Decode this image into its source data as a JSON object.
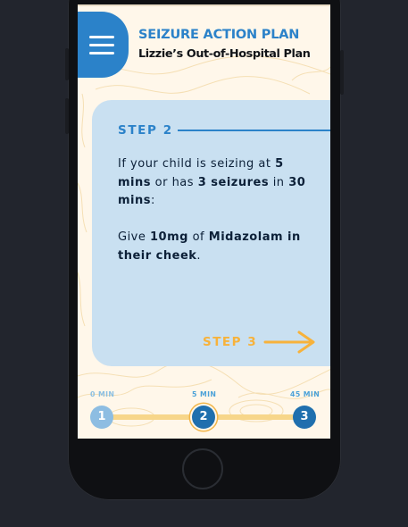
{
  "header": {
    "title": "SEIZURE ACTION PLAN",
    "subtitle": "Lizzie’s Out-of-Hospital Plan",
    "menu_icon": "hamburger-menu-icon"
  },
  "step": {
    "label": "STEP 2",
    "condition": {
      "pre": "If your child is seizing at ",
      "time": "5 mins",
      "mid": " or has ",
      "count": "3 seizures",
      "mid2": " in ",
      "window": "30 mins",
      "post": ":"
    },
    "action": {
      "pre": "Give ",
      "dose": "10mg",
      "mid": " of ",
      "drug": "Midazolam in their cheek",
      "post": "."
    },
    "next_label": "STEP 3",
    "next_icon": "arrow-right-icon"
  },
  "timeline": {
    "points": [
      {
        "label": "0 MIN",
        "number": "1"
      },
      {
        "label": "5 MIN",
        "number": "2"
      },
      {
        "label": "45 MIN",
        "number": "3"
      }
    ],
    "active_index": 1
  },
  "colors": {
    "primary_blue": "#2b82c9",
    "card_blue": "#c9e0f1",
    "accent_yellow": "#f7b23b",
    "dark_text": "#0c2038",
    "background": "#fff7ea"
  }
}
